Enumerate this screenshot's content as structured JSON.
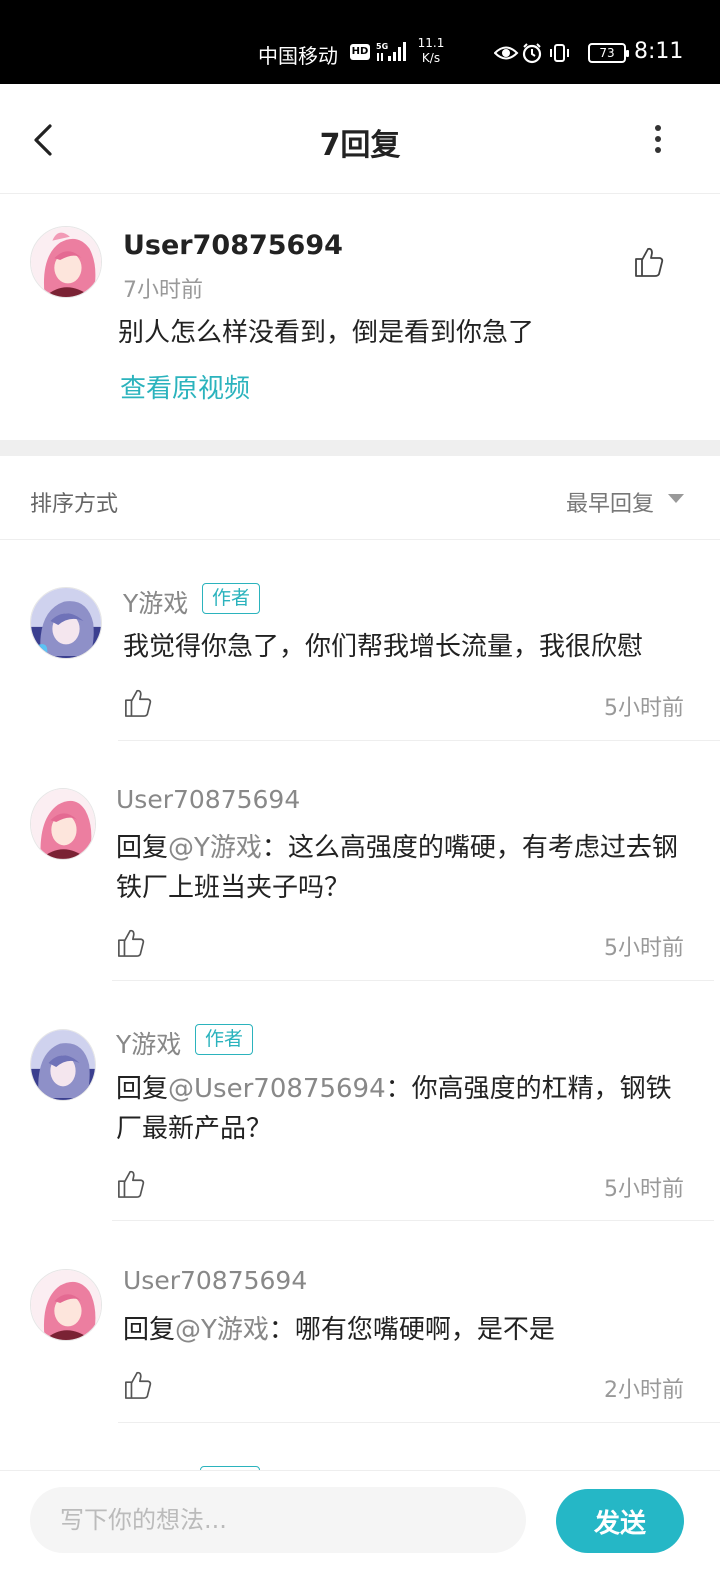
{
  "status_bar": {
    "carrier": "中国移动",
    "hd": "HD",
    "network": "5G",
    "speed_value": "11.1",
    "speed_unit": "K/s",
    "battery": "73",
    "time": "8:11"
  },
  "header": {
    "title": "7回复"
  },
  "main_comment": {
    "user": "User70875694",
    "time": "7小时前",
    "text": "别人怎么样没看到，倒是看到你急了",
    "link": "查看原视频"
  },
  "sort": {
    "label": "排序方式",
    "value": "最早回复"
  },
  "author_badge": "作者",
  "replies": [
    {
      "user": "Y游戏",
      "is_author": true,
      "mention": "",
      "mention_prefix": "",
      "mention_suffix": "",
      "text": "我觉得你急了，你们帮我增长流量，我很欣慰",
      "time": "5小时前"
    },
    {
      "user": "User70875694",
      "is_author": false,
      "mention_prefix": "回复",
      "mention": "@Y游戏",
      "mention_suffix": "：",
      "text": "这么高强度的嘴硬，有考虑过去钢铁厂上班当夹子吗？",
      "time": "5小时前"
    },
    {
      "user": "Y游戏",
      "is_author": true,
      "mention_prefix": "回复",
      "mention": "@User70875694",
      "mention_suffix": "：",
      "text": "你高强度的杠精，钢铁厂最新产品？",
      "time": "5小时前"
    },
    {
      "user": "User70875694",
      "is_author": false,
      "mention_prefix": "回复",
      "mention": "@Y游戏",
      "mention_suffix": "：",
      "text": "哪有您嘴硬啊，是不是",
      "time": "2小时前"
    }
  ],
  "input": {
    "placeholder": "写下你的想法..."
  },
  "send_button": "发送",
  "colors": {
    "accent": "#25b7c6",
    "link": "#2bb3bd"
  },
  "icons": {
    "back": "chevron-left-icon",
    "more": "more-vertical-icon",
    "like": "thumbs-up-icon",
    "sort": "chevron-down-icon"
  }
}
